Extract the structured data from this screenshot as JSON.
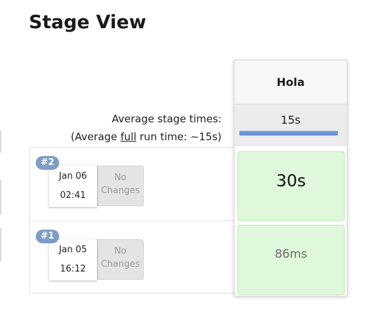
{
  "page": {
    "title": "Stage View"
  },
  "summary": {
    "average_label": "Average stage times:",
    "full_prefix": "(Average ",
    "full_word": "full",
    "full_suffix": " run time: ~15s)"
  },
  "stage": {
    "name": "Hola",
    "average_time": "15s",
    "average_progress": 1.0
  },
  "runs": [
    {
      "badge": "#2",
      "date": "Jan 06",
      "time": "02:41",
      "changes_line1": "No",
      "changes_line2": "Changes",
      "stage_duration": "30s"
    },
    {
      "badge": "#1",
      "date": "Jan 05",
      "time": "16:12",
      "changes_line1": "No",
      "changes_line2": "Changes",
      "stage_duration": "86ms"
    }
  ],
  "colors": {
    "success_cell": "#dff7da",
    "badge": "#7d9dc6",
    "progress": "#6f96d2"
  }
}
